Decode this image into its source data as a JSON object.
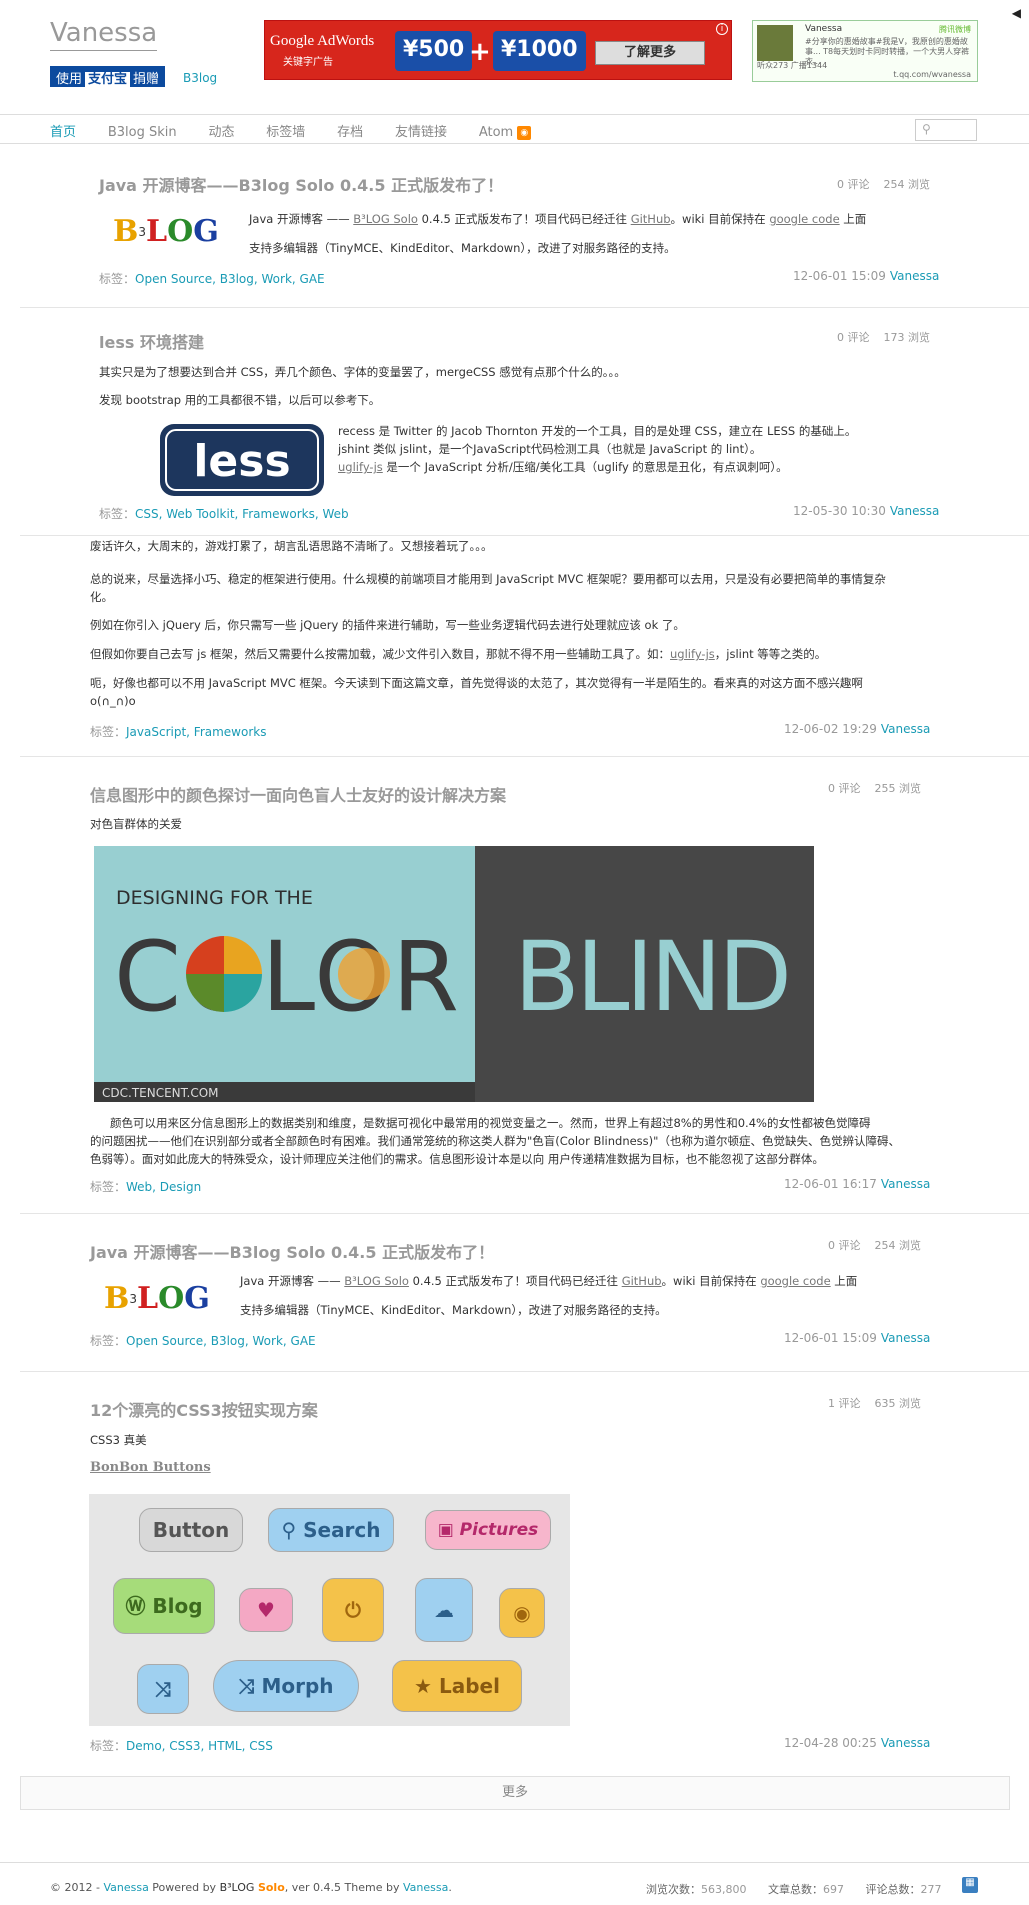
{
  "header": {
    "logo": "Vanessa",
    "alipay_pre": "使用",
    "alipay_brand": "支付宝",
    "alipay_post": "捐赠",
    "b3log_link": "B3log",
    "ad": {
      "brand": "Google AdWords",
      "sub": "关键字广告",
      "coin1": "¥500",
      "coin2": "¥1000",
      "button": "了解更多"
    },
    "weibo": {
      "name": "Vanessa",
      "brand": "腾讯微博",
      "text": "#分享你的惠婚故事#我是V，我原创的惠婚故事... T8每天划时卡同时转播，一个大男人穿裤衣...",
      "stats": "听众273 广播1344",
      "url": "t.qq.com/wvanessa"
    },
    "collapse_icon": "◀"
  },
  "nav": {
    "items": [
      "首页",
      "B3log Skin",
      "动态",
      "标签墙",
      "存档",
      "友情链接",
      "Atom"
    ],
    "search_icon": "⚲"
  },
  "posts": [
    {
      "title": "Java 开源博客——B3log Solo 0.4.5 正式版发布了！",
      "comments": "0 评论",
      "views": "254 浏览",
      "line1_a": "Java 开源博客 —— ",
      "line1_link": "B³LOG Solo",
      "line1_b": " 0.4.5 正式版发布了！项目代码已经迁往 ",
      "line1_gh": "GitHub",
      "line1_c": "。wiki 目前保持在 ",
      "line1_gc": "google code",
      "line1_d": " 上面",
      "line2": "支持多编辑器（TinyMCE、KindEditor、Markdown），改进了对服务路径的支持。",
      "tags_label": "标签：",
      "tags": "Open Source, B3log, Work, GAE",
      "date": "12-06-01 15:09",
      "author": "Vanessa"
    },
    {
      "title": "less 环境搭建",
      "comments": "0 评论",
      "views": "173 浏览",
      "p1": "其实只是为了想要达到合并 CSS，弄几个颜色、字体的变量罢了，mergeCSS 感觉有点那个什么的。。。",
      "p2": "发现 bootstrap 用的工具都很不错，以后可以参考下。",
      "l1": "recess 是 Twitter 的 Jacob Thornton 开发的一个工具，目的是处理 CSS，建立在 LESS 的基础上。",
      "l2": "jshint 类似 jslint，是一个JavaScript代码检测工具（也就是 JavaScript 的 lint）。",
      "l3_link": "uglify-js",
      "l3": " 是一个 JavaScript 分析/压缩/美化工具（uglify 的意思是丑化，有点讽刺呵）。",
      "less_logo": "less",
      "tags_label": "标签：",
      "tags": "CSS, Web Toolkit, Frameworks, Web",
      "date": "12-05-30 10:30",
      "author": "Vanessa"
    },
    {
      "p1": "废话许久，大周末的，游戏打累了，胡言乱语思路不清晰了。又想接着玩了。。。",
      "p2a": "总的说来，尽量选择小巧、稳定的框架进行使用。什么规模的前端项目才能用到 JavaScript MVC 框架呢？要用都可以去用，只是没有必要把简单的事情复杂",
      "p2b": "化。",
      "p3": "例如在你引入 jQuery 后，你只需写一些 jQuery 的插件来进行辅助，写一些业务逻辑代码去进行处理就应该 ok 了。",
      "p4a": "但假如你要自己去写 js 框架，然后又需要什么按需加载，减少文件引入数目，那就不得不用一些辅助工具了。如：",
      "p4link": "uglify-js",
      "p4b": "，jslint 等等之类的。",
      "p5a": "呃，好像也都可以不用 JavaScript MVC 框架。今天读到下面这篇文章，首先觉得谈的太范了，其次觉得有一半是陌生的。看来真的对这方面不感兴趣啊",
      "p5b": "o(∩_∩)o",
      "tags_label": "标签：",
      "tags": "JavaScript, Frameworks",
      "date": "12-06-02 19:29",
      "author": "Vanessa"
    },
    {
      "title": "信息图形中的颜色探讨一面向色盲人士友好的设计解决方案",
      "comments": "0 评论",
      "views": "255 浏览",
      "sub": "对色盲群体的关爱",
      "img_top": "DESIGNING FOR THE",
      "img_color": "COLOR",
      "img_blind": "BLIND",
      "img_src": "CDC.TENCENT.COM",
      "body1": "颜色可以用来区分信息图形上的数据类别和维度，是数据可视化中最常用的视觉变量之一。然而，世界上有超过8%的男性和0.4%的女性都被色觉障碍",
      "body2": "的问题困扰——他们在识别部分或者全部颜色时有困难。我们通常笼统的称这类人群为\"色盲(Color Blindness)\"（也称为道尔顿症、色觉缺失、色觉辨认障碍、",
      "body3": "色弱等）。面对如此庞大的特殊受众，设计师理应关注他们的需求。信息图形设计本是以向 用户传递精准数据为目标，也不能忽视了这部分群体。",
      "tags_label": "标签：",
      "tags": "Web, Design",
      "date": "12-06-01 16:17",
      "author": "Vanessa"
    },
    {
      "title": "Java 开源博客——B3log Solo 0.4.5 正式版发布了！",
      "comments": "0 评论",
      "views": "254 浏览",
      "tags_label": "标签：",
      "tags": "Open Source, B3log, Work, GAE",
      "date": "12-06-01 15:09",
      "author": "Vanessa"
    },
    {
      "title": "12个漂亮的CSS3按钮实现方案",
      "comments": "1 评论",
      "views": "635 浏览",
      "sub": "CSS3 真美",
      "link": "BonBon Buttons",
      "buttons": [
        "Button",
        "Search",
        "Pictures",
        "Blog",
        "Morph",
        "Label"
      ],
      "tags_label": "标签：",
      "tags": "Demo, CSS3, HTML, CSS",
      "date": "12-04-28 00:25",
      "author": "Vanessa"
    }
  ],
  "more": "更多",
  "footer": {
    "copy": "© 2012 - ",
    "author": "Vanessa",
    "powered": " Powered by ",
    "b3": "B³LOG",
    "solo": "Solo",
    "ver": ", ver 0.4.5   Theme by ",
    "theme_author": "Vanessa",
    "views_label": "浏览次数：",
    "views": "563,800",
    "articles_label": "文章总数：",
    "articles": "697",
    "comments_label": "评论总数：",
    "comments": "277"
  }
}
